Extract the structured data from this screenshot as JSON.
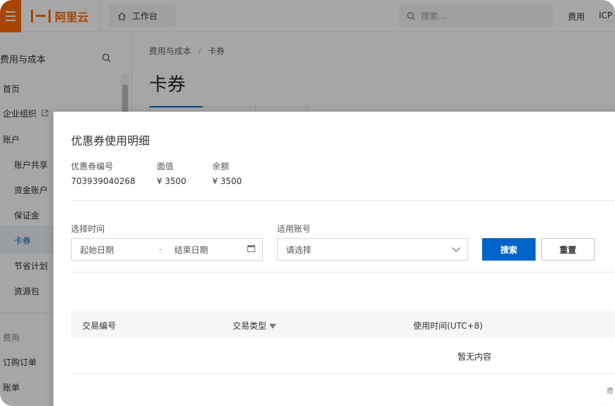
{
  "topbar": {
    "brand": "阿里云",
    "workbench_label": "工作台",
    "search_placeholder": "搜索...",
    "links": [
      "费用",
      "ICP"
    ]
  },
  "sidebar": {
    "title": "费用与成本",
    "items": [
      {
        "label": "首页"
      },
      {
        "label": "企业组织"
      },
      {
        "label": "账户"
      },
      {
        "label": "账户共享"
      },
      {
        "label": "资金账户"
      },
      {
        "label": "保证金"
      },
      {
        "label": "卡券"
      },
      {
        "label": "节省计划"
      },
      {
        "label": "资源包"
      }
    ],
    "groups": [
      {
        "label": "费用"
      },
      {
        "label": "订购订单"
      },
      {
        "label": "账单"
      }
    ]
  },
  "main": {
    "breadcrumb": [
      "费用与成本",
      "卡券"
    ],
    "title": "卡券"
  },
  "dialog": {
    "title": "优惠券使用明细",
    "info": [
      {
        "label": "优惠券编号",
        "value": "703939040268"
      },
      {
        "label": "面值",
        "value": "¥ 3500"
      },
      {
        "label": "余额",
        "value": "¥ 3500"
      }
    ],
    "filters": {
      "time_label": "选择时间",
      "start_placeholder": "起始日期",
      "range_sep": "-",
      "end_placeholder": "结束日期",
      "account_label": "适用账号",
      "account_placeholder": "请选择",
      "search_btn": "搜索",
      "reset_btn": "重置"
    },
    "table": {
      "columns": [
        "交易编号",
        "交易类型",
        "使用时间(UTC+8)"
      ],
      "empty_text": "暂无内容"
    },
    "corner_text": "奇"
  }
}
